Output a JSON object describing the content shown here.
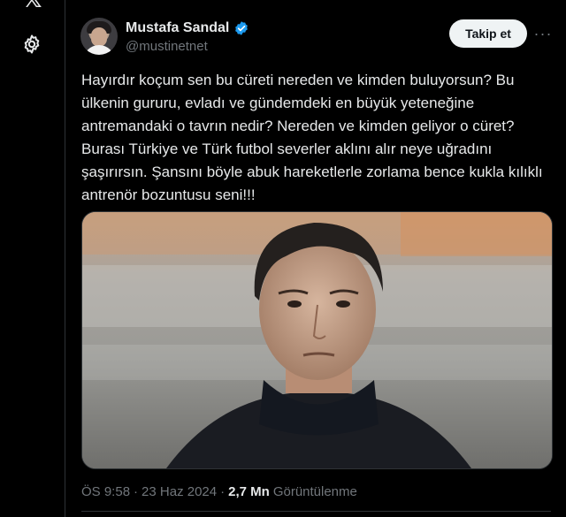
{
  "sidebar": {
    "logo_icon": "x-logo-icon",
    "settings_icon": "gear-icon"
  },
  "tweet": {
    "author": {
      "display_name": "Mustafa Sandal",
      "handle": "@mustinetnet",
      "verified_color": "#1d9bf0"
    },
    "follow_label": "Takip et",
    "more_label": "···",
    "text": "Hayırdır koçum sen bu cüreti nereden ve kimden buluyorsun? Bu ülkenin gururu, evladı ve gündemdeki en büyük yeteneğine antremandaki o tavrın nedir? Nereden ve kimden geliyor o cüret? Burası Türkiye ve Türk futbol severler aklını alır neye uğradını şaşırırsın. Şansını böyle abuk hareketlerle zorlama bence kukla kılıklı antrenör bozuntusu seni!!!",
    "meta": {
      "time": "ÖS 9:58",
      "separator": "·",
      "date": "23 Haz 2024",
      "separator2": "·",
      "views_count": "2,7 Mn",
      "views_label": "Görüntülenme"
    }
  },
  "colors": {
    "background": "#000000",
    "text_primary": "#e7e9ea",
    "text_secondary": "#71767b",
    "follow_bg": "#eff3f4",
    "border": "#2f3336"
  }
}
